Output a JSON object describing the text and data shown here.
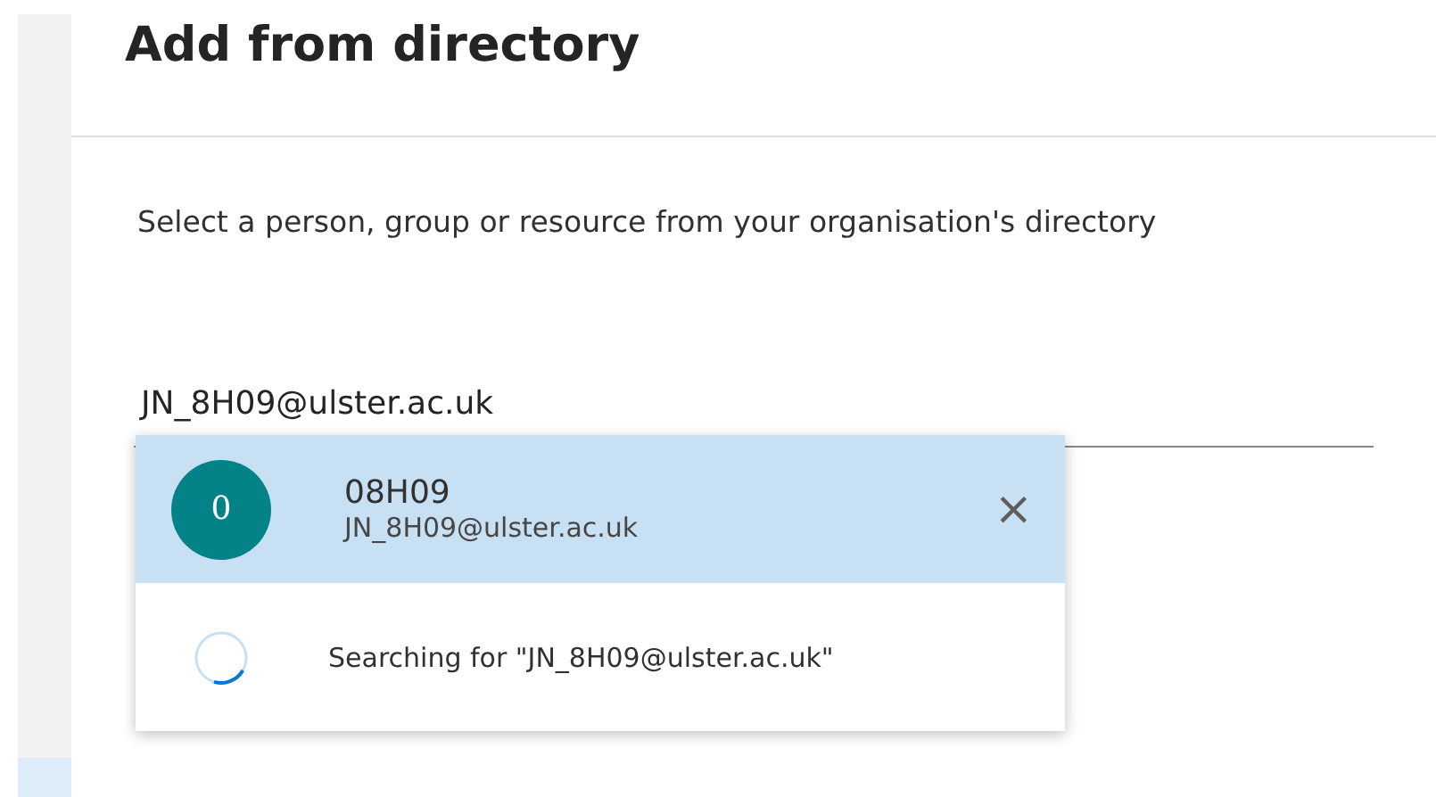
{
  "dialog": {
    "title": "Add from directory",
    "description": "Select a person, group or resource from your organisation's directory"
  },
  "search_field": {
    "value": "JN_8H09@ulster.ac.uk"
  },
  "suggestions": [
    {
      "kind": "person",
      "avatar": "0",
      "name": "08H09",
      "email": "JN_8H09@ulster.ac.uk",
      "selected": true,
      "remove": "×"
    },
    {
      "kind": "searching",
      "text": "Searching for \"JN_8H09@ulster.ac.uk\"",
      "selected": false
    }
  ]
}
